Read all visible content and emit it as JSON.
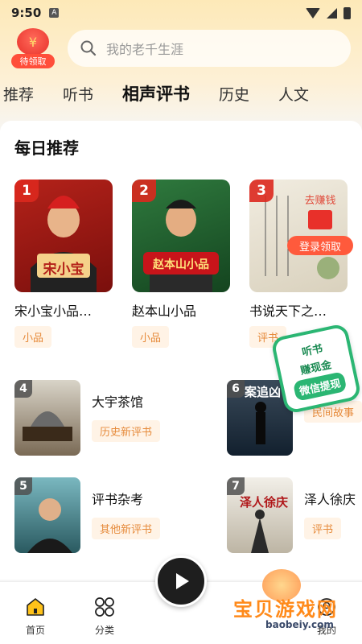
{
  "status": {
    "time": "9:50",
    "sim": "A"
  },
  "header": {
    "gift_label": "待领取",
    "search_placeholder": "我的老千生涯"
  },
  "tabs": [
    "推荐",
    "听书",
    "相声评书",
    "历史",
    "人文"
  ],
  "active_tab": "相声评书",
  "section": {
    "title": "每日推荐"
  },
  "top_items": [
    {
      "rank": "1",
      "title": "宋小宝小品…",
      "tag": "小品",
      "cover_text": "宋小宝"
    },
    {
      "rank": "2",
      "title": "赵本山小品",
      "tag": "小品",
      "cover_text": "赵本山小品"
    },
    {
      "rank": "3",
      "title": "书说天下之…",
      "tag": "评书",
      "cover_text": ""
    }
  ],
  "float_promo": {
    "top": "去赚钱",
    "button": "登录领取"
  },
  "earn_badge": {
    "line1": "听书",
    "line2": "赚现金",
    "line3": "微信提现"
  },
  "list_items": [
    {
      "rank": "4",
      "title": "大宇茶馆",
      "tag": "历史新评书"
    },
    {
      "rank": "6",
      "title": "",
      "tag": "民间故事"
    },
    {
      "rank": "5",
      "title": "评书杂考",
      "tag": "其他新评书"
    },
    {
      "rank": "7",
      "title": "泽人徐庆",
      "tag": "评书"
    }
  ],
  "thumb_texts": {
    "t6": "案追凶",
    "t7": "泽人徐庆"
  },
  "bottom_nav": {
    "home": "首页",
    "category": "分类",
    "mine": "我的"
  },
  "watermark": {
    "big": "宝贝游戏网",
    "url": "baobeiy.com"
  },
  "colors": {
    "accent": "#e68a3a",
    "green": "#2bb673",
    "red": "#e8302a"
  }
}
